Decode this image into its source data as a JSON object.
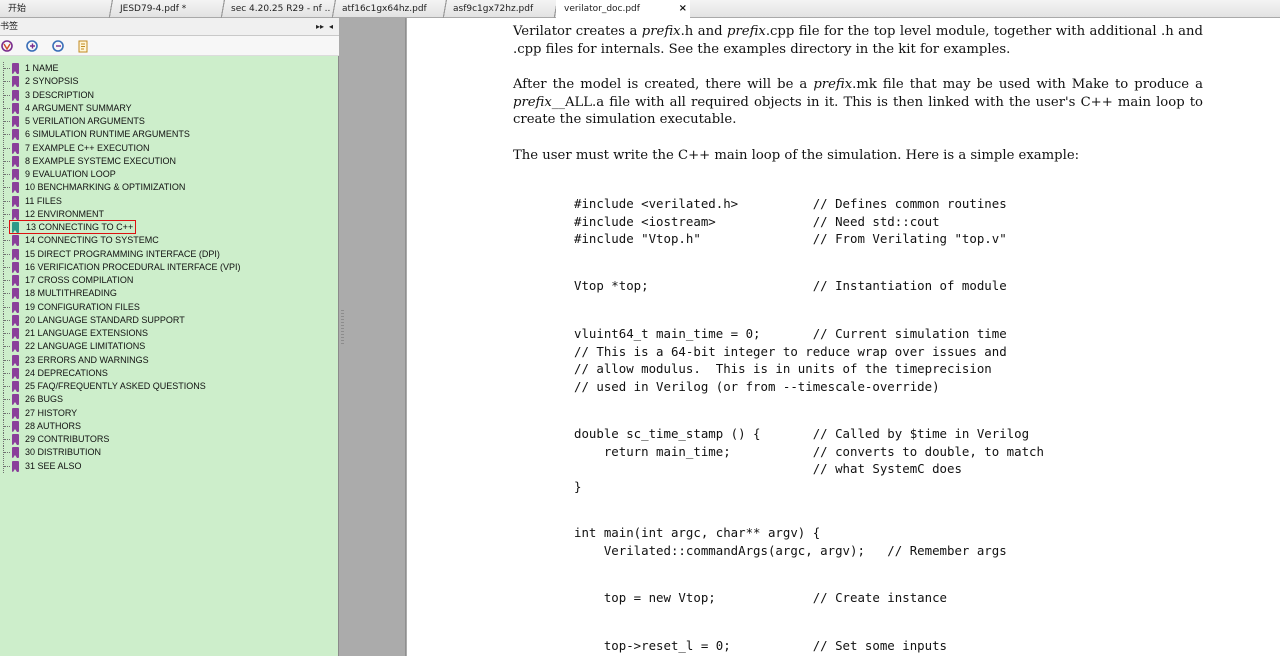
{
  "tabs": [
    {
      "label": "开始"
    },
    {
      "label": "JESD79-4.pdf *"
    },
    {
      "label": "sec 4.20.25 R29 - nf ..."
    },
    {
      "label": "atf16c1gx64hz.pdf"
    },
    {
      "label": "asf9c1gx72hz.pdf"
    },
    {
      "label": "verilator_doc.pdf",
      "close": "×"
    }
  ],
  "sidebar": {
    "title": "书签",
    "header_buttons": [
      "▸▸",
      "◂"
    ],
    "bookmarks": [
      "1 NAME",
      "2 SYNOPSIS",
      "3 DESCRIPTION",
      "4 ARGUMENT SUMMARY",
      "5 VERILATION ARGUMENTS",
      "6 SIMULATION RUNTIME ARGUMENTS",
      "7 EXAMPLE C++ EXECUTION",
      "8 EXAMPLE SYSTEMC EXECUTION",
      "9 EVALUATION LOOP",
      "10 BENCHMARKING & OPTIMIZATION",
      "11 FILES",
      "12 ENVIRONMENT",
      "13 CONNECTING TO C++",
      "14 CONNECTING TO SYSTEMC",
      "15 DIRECT PROGRAMMING INTERFACE (DPI)",
      "16 VERIFICATION PROCEDURAL INTERFACE (VPI)",
      "17 CROSS COMPILATION",
      "18 MULTITHREADING",
      "19 CONFIGURATION FILES",
      "20 LANGUAGE STANDARD SUPPORT",
      "21 LANGUAGE EXTENSIONS",
      "22 LANGUAGE LIMITATIONS",
      "23 ERRORS AND WARNINGS",
      "24 DEPRECATIONS",
      "25 FAQ/FREQUENTLY ASKED QUESTIONS",
      "26 BUGS",
      "27 HISTORY",
      "28 AUTHORS",
      "29 CONTRIBUTORS",
      "30 DISTRIBUTION",
      "31 SEE ALSO"
    ],
    "selected_index": 12
  },
  "document": {
    "para1": {
      "a": "Verilator creates a ",
      "b": "prefix",
      "c": ".h and ",
      "d": "prefix",
      "e": ".cpp file for the top level module, together with additional .h and .cpp files for internals. See the examples directory in the kit for examples."
    },
    "para2": {
      "a": "After the model is created, there will be a ",
      "b": "prefix",
      "c": ".mk file that may be used with Make to produce a ",
      "d": "prefix",
      "e": "__ALL.a file with all required objects in it. This is then linked with the user's C++ main loop to create the simulation executable."
    },
    "para3": "The user must write the C++ main loop of the simulation. Here is a simple example:",
    "code_lines": [
      "#include <verilated.h>          // Defines common routines",
      "#include <iostream>             // Need std::cout",
      "#include \"Vtop.h\"               // From Verilating \"top.v\"",
      "Vtop *top;                      // Instantiation of module",
      "vluint64_t main_time = 0;       // Current simulation time",
      "// This is a 64-bit integer to reduce wrap over issues and",
      "// allow modulus.  This is in units of the timeprecision",
      "// used in Verilog (or from --timescale-override)",
      "double sc_time_stamp () {       // Called by $time in Verilog",
      "    return main_time;           // converts to double, to match",
      "                                // what SystemC does",
      "}",
      "int main(int argc, char** argv) {",
      "    Verilated::commandArgs(argc, argv);   // Remember args",
      "    top = new Vtop;             // Create instance",
      "    top->reset_l = 0;           // Set some inputs"
    ]
  }
}
